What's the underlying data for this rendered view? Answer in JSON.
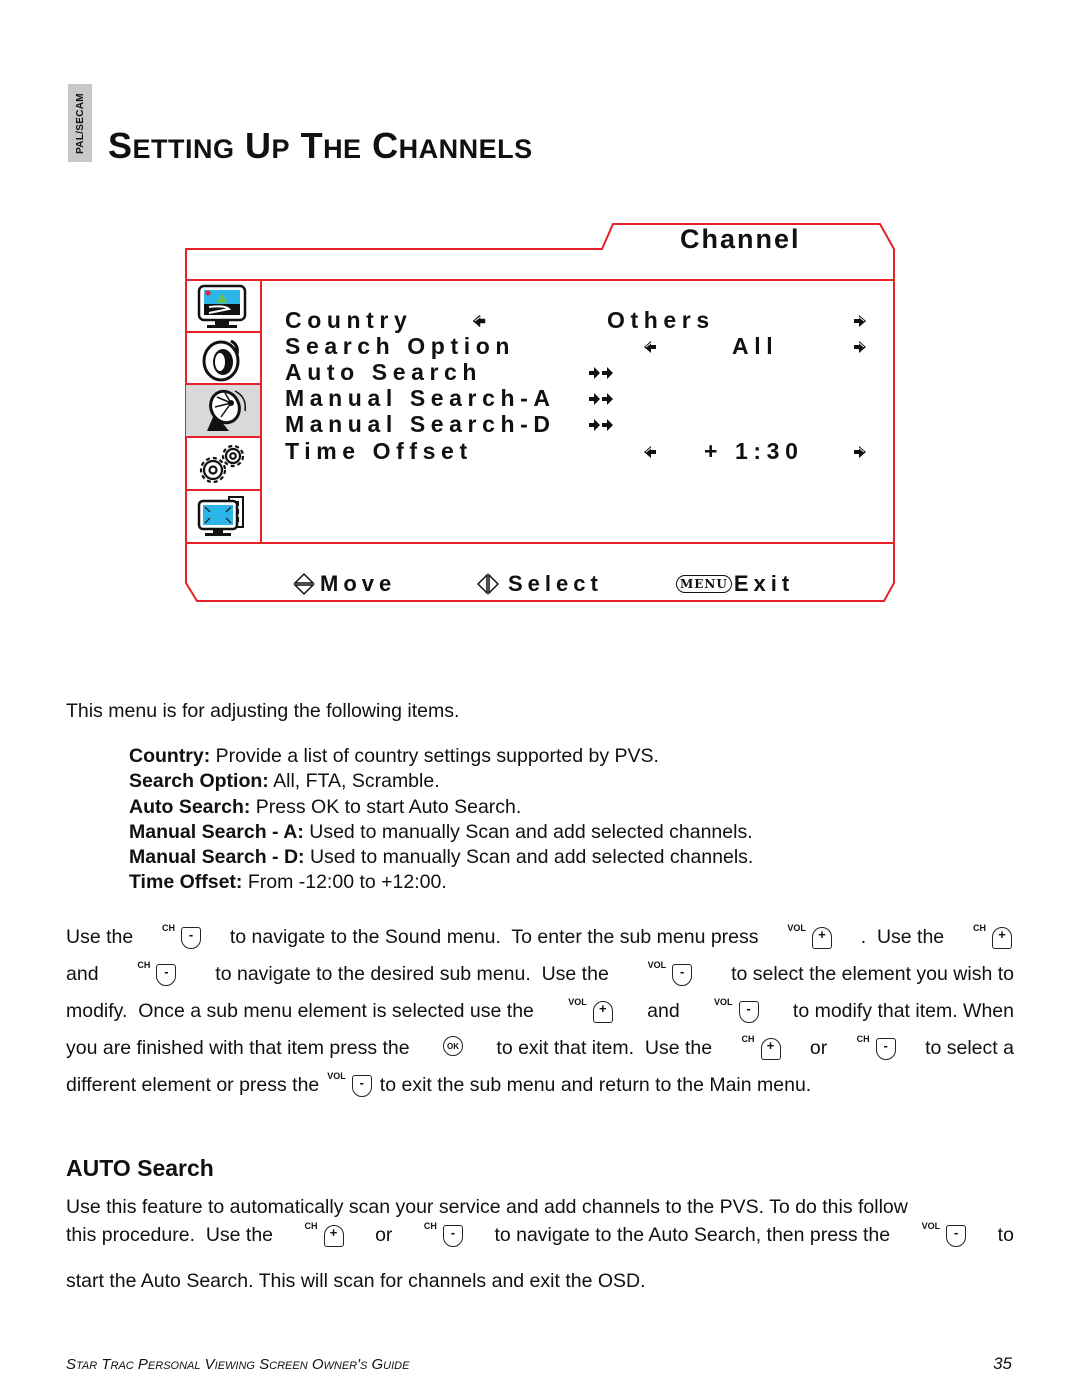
{
  "side_tab": "PAL/SECAM",
  "page_title": "Setting Up The Channels",
  "page_title_words": [
    {
      "cap": "S",
      "rest": "ETTING"
    },
    {
      "cap": "U",
      "rest": "P"
    },
    {
      "cap": "T",
      "rest": "HE"
    },
    {
      "cap": "C",
      "rest": "HANNELS"
    }
  ],
  "osd": {
    "title": "Channel",
    "accent_color": "#e8202a",
    "sidebar_icons": [
      {
        "name": "picture-icon",
        "active": false
      },
      {
        "name": "sound-icon",
        "active": false
      },
      {
        "name": "satellite-dish-icon",
        "active": true
      },
      {
        "name": "gears-icon",
        "active": false
      },
      {
        "name": "screen-resize-icon",
        "active": false
      }
    ],
    "items": [
      {
        "label": "Country",
        "value": "Others",
        "control": "left-right"
      },
      {
        "label": "Search Option",
        "value": "All",
        "control": "left-right"
      },
      {
        "label": "Auto Search",
        "value": "",
        "control": "enter"
      },
      {
        "label": "Manual Search-A",
        "value": "",
        "control": "enter"
      },
      {
        "label": "Manual Search-D",
        "value": "",
        "control": "enter"
      },
      {
        "label": "Time Offset",
        "value": "+ 1:30",
        "control": "left-right"
      }
    ],
    "footer": {
      "move": "Move",
      "select": "Select",
      "menu_key": "MENU",
      "exit": "Exit"
    }
  },
  "intro": "This menu is for adjusting the following items.",
  "definitions": [
    {
      "term": "Country:",
      "text": " Provide a list of country settings supported by PVS."
    },
    {
      "term": "Search Option:",
      "text": " All, FTA, Scramble."
    },
    {
      "term": "Auto Search:",
      "text": " Press OK to start Auto Search."
    },
    {
      "term": "Manual Search - A:",
      "text": " Used to manually Scan and add selected channels."
    },
    {
      "term": "Manual Search - D:",
      "text": " Used to manually Scan and add selected channels."
    },
    {
      "term": "Time Offset:",
      "text": " From -12:00 to +12:00."
    }
  ],
  "instructions": {
    "l1": [
      "Use the",
      "to navigate to the Sound menu.  To enter the sub menu press",
      ".  Use the"
    ],
    "l2": [
      "and",
      "to navigate to the desired sub menu.  Use the",
      "to select the element you wish to"
    ],
    "l3": [
      "modify.  Once a sub menu element is selected use the",
      "and",
      "to modify that item. When"
    ],
    "l4": [
      "you are finished with that item press the",
      "to exit that item.  Use the",
      "or",
      "to select a"
    ],
    "l5": [
      "different element or press the",
      "to exit the sub menu and return to the Main menu."
    ]
  },
  "keys": {
    "ch": "CH",
    "vol": "VOL",
    "ok": "OK",
    "plus": "+",
    "minus": "-"
  },
  "auto_search": {
    "heading": "AUTO Search",
    "l1": "Use this feature to automatically scan your service and add channels to the PVS.  To do this follow",
    "l2": [
      "this procedure.  Use the",
      "or",
      "to navigate to the Auto Search, then press the",
      "to"
    ],
    "l3": "start the Auto Search.  This will scan for channels and exit the OSD."
  },
  "footer": {
    "guide": "Star Trac Personal Viewing Screen Owner's Guide",
    "page_number": "35"
  }
}
